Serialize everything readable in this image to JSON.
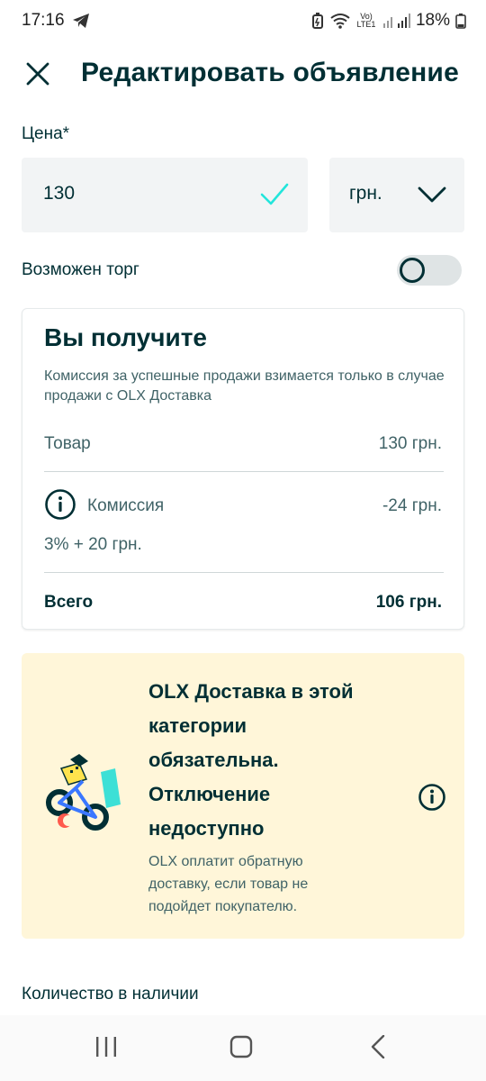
{
  "status_bar": {
    "time": "17:16",
    "battery": "18%",
    "network": "Vo) LTE1"
  },
  "header": {
    "title": "Редактировать объявление",
    "close_icon": "close-icon"
  },
  "price": {
    "label": "Цена*",
    "value": "130",
    "currency": "грн."
  },
  "negotiable": {
    "label": "Возможен торг",
    "enabled": false
  },
  "receive": {
    "title": "Вы получите",
    "description": "Комиссия за успешные продажи взимается только в случае продажи с OLX Доставка",
    "item_label": "Товар",
    "item_value": "130 грн.",
    "commission_label": "Комиссия",
    "commission_value": "-24 грн.",
    "commission_formula": "3% + 20 грн.",
    "total_label": "Всего",
    "total_value": "106 грн."
  },
  "delivery": {
    "title": "OLX Доставка в этой категории обязательна. Отключение недоступно",
    "description": "OLX оплатит обратную доставку, если товар не подойдет покупателю."
  },
  "quantity": {
    "label": "Количество в наличии"
  },
  "colors": {
    "primary_text": "#002f34",
    "secondary_text": "#406367",
    "field_bg": "#f2f4f5",
    "check_accent": "#23e5db",
    "promo_bg": "#fff6d9"
  }
}
